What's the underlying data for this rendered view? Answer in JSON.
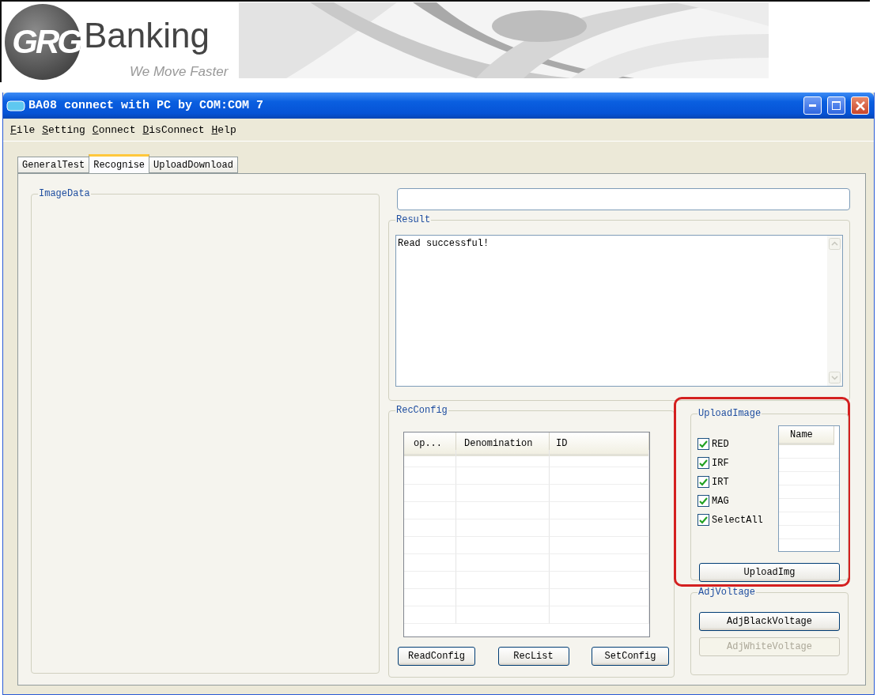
{
  "banner": {
    "logo_mark": "GRG",
    "brand": "Banking",
    "slogan": "We Move Faster"
  },
  "window": {
    "title": "BA08 connect with PC by COM:COM 7"
  },
  "menu": [
    {
      "accel": "F",
      "rest": "ile"
    },
    {
      "accel": "S",
      "rest": "etting"
    },
    {
      "accel": "C",
      "rest": "onnect"
    },
    {
      "accel": "D",
      "rest": "isConnect"
    },
    {
      "accel": "H",
      "rest": "elp"
    }
  ],
  "tabs": [
    {
      "label": "GeneralTest",
      "selected": false
    },
    {
      "label": "Recognise",
      "selected": true
    },
    {
      "label": "UploadDownload",
      "selected": false
    }
  ],
  "image_data": {
    "title": "ImageData"
  },
  "result": {
    "title": "Result",
    "text": "Read successful!"
  },
  "rec_config": {
    "title": "RecConfig",
    "columns": [
      "op...",
      "Denomination",
      "ID"
    ],
    "buttons": [
      "ReadConfig",
      "RecList",
      "SetConfig"
    ]
  },
  "upload_image": {
    "title": "UploadImage",
    "highlighted": true,
    "options": [
      {
        "label": "RED",
        "checked": true
      },
      {
        "label": "IRF",
        "checked": true
      },
      {
        "label": "IRT",
        "checked": true
      },
      {
        "label": "MAG",
        "checked": true
      },
      {
        "label": "SelectAll",
        "checked": true
      }
    ],
    "list_column": "Name",
    "button": "UploadImg"
  },
  "adj_voltage": {
    "title": "AdjVoltage",
    "buttons": [
      {
        "label": "AdjBlackVoltage",
        "disabled": false
      },
      {
        "label": "AdjWhiteVoltage",
        "disabled": true
      }
    ]
  }
}
